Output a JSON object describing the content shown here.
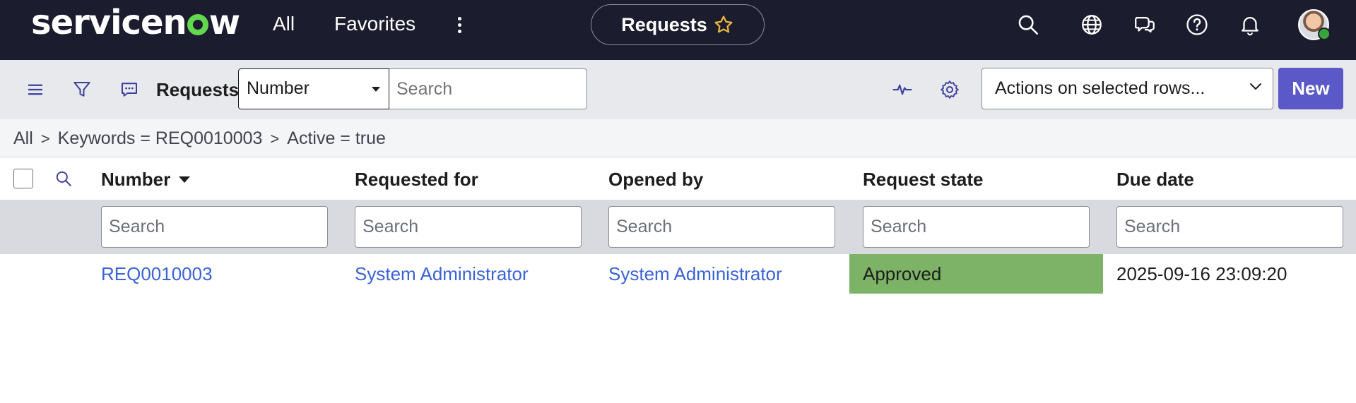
{
  "topbar": {
    "logo_text_a": "servicen",
    "logo_text_b": "w",
    "nav_all": "All",
    "nav_favorites": "Favorites",
    "context_title": "Requests",
    "icons": [
      "search-icon",
      "globe-icon",
      "chat-icon",
      "help-icon",
      "bell-icon"
    ],
    "accent_color": "#62d84e",
    "bar_color": "#1b1c2e"
  },
  "toolbar": {
    "title": "Requests",
    "search_field_selected": "Number",
    "search_placeholder": "Search",
    "actions_select": "Actions on selected rows...",
    "new_label": "New",
    "new_color": "#5b58c8"
  },
  "breadcrumb": {
    "items": [
      "All",
      "Keywords = REQ0010003",
      "Active = true"
    ],
    "separator": ">"
  },
  "table": {
    "columns": [
      "Number",
      "Requested for",
      "Opened by",
      "Request state",
      "Due date"
    ],
    "filter_placeholder": "Search",
    "rows": [
      {
        "number": "REQ0010003",
        "requested_for": "System Administrator",
        "opened_by": "System Administrator",
        "request_state": "Approved",
        "due_date": "2025-09-16 23:09:20"
      }
    ],
    "state_color": "#7db366",
    "link_color": "#3b63d6"
  }
}
